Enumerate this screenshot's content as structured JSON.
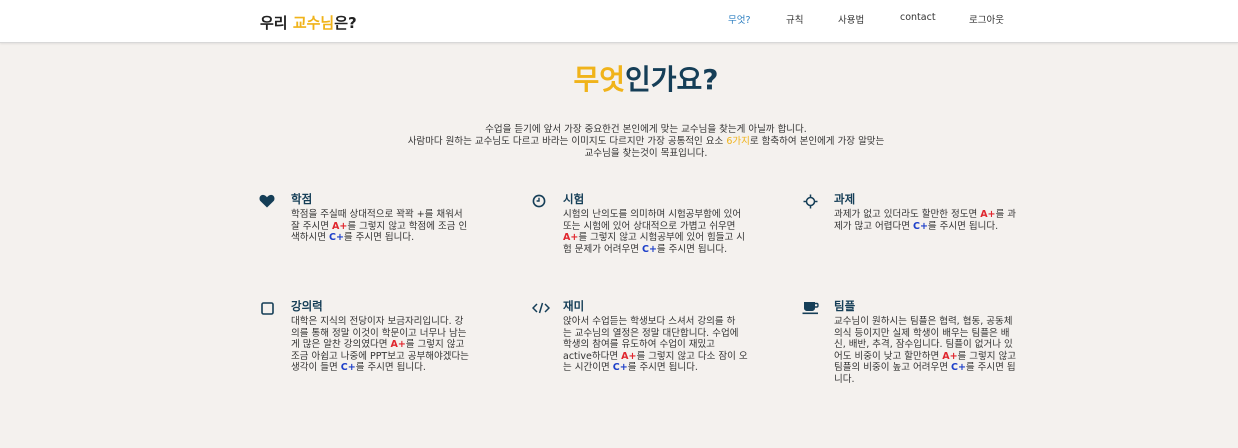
{
  "nav": {
    "brand_prefix": "우리 ",
    "brand_highlight": "교수님",
    "brand_suffix": "은?",
    "links": [
      "무엇?",
      "규칙",
      "사용법",
      "contact",
      "로그아웃"
    ]
  },
  "hero": {
    "title_highlight": "무엇",
    "title_rest": "인가요?"
  },
  "intro": {
    "line1": "수업을 듣기에 앞서 가장 중요한건 본인에게 맞는 교수님을 찾는게 아닐까 합니다.",
    "line2_a": "사람마다 원하는 교수님도 다르고 바라는 이미지도 다르지만 가장 공통적인 요소 ",
    "line2_highlight": "6가지",
    "line2_b": "로 함축하여 본인에게 가장 알맞는",
    "line3": "교수님을 찾는것이 목표입니다."
  },
  "grade_labels": {
    "a": "A+",
    "c": "C+"
  },
  "features": [
    {
      "icon": "heart-icon",
      "title": "학점",
      "lines": [
        [
          "학점을 주실때 상대적으로 꽉꽉 +를 채워서"
        ],
        [
          "잘 주시면 ",
          "@A",
          "를 그렇지 않고 학점에 조금 인"
        ],
        [
          "색하시면 ",
          "@C",
          "를 주시면 됩니다."
        ]
      ]
    },
    {
      "icon": "clock-icon",
      "title": "시험",
      "lines": [
        [
          "시험의 난의도를 의미하며 시험공부함에 있어"
        ],
        [
          "또는 시험에 있어 상대적으로 가볍고 쉬우면"
        ],
        [
          "@A",
          "를 그렇지 않고 시험공부에 있어 힘들고 시"
        ],
        [
          "험 문제가 어려우면 ",
          "@C",
          "를 주시면 됩니다."
        ]
      ]
    },
    {
      "icon": "crosshair-icon",
      "title": "과제",
      "lines": [
        [
          "과제가 없고 있더라도 할만한 정도면 ",
          "@A",
          "를 과"
        ],
        [
          "제가 많고 어렵다면 ",
          "@C",
          "를 주시면 됩니다."
        ]
      ]
    },
    {
      "icon": "square-icon",
      "title": "강의력",
      "lines": [
        [
          "대학은 지식의 전당이자 보금자리입니다. 강"
        ],
        [
          "의를 통해 정말 이것이 학문이고 너무나 남는"
        ],
        [
          "게 많은 알찬 강의였다면 ",
          "@A",
          "를 그렇지 않고"
        ],
        [
          "조금 아쉽고 나중에 PPT보고 공부해야겠다는"
        ],
        [
          "생각이 들면 ",
          "@C",
          "를 주시면 됩니다."
        ]
      ]
    },
    {
      "icon": "code-icon",
      "title": "재미",
      "lines": [
        [
          "앉아서 수업듣는 학생보다 스셔서 강의를 하"
        ],
        [
          "는 교수님의 열정은 정말 대단합니다. 수업에"
        ],
        [
          "학생의 참여를 유도하여 수업이 재밌고"
        ],
        [
          "active하다면 ",
          "@A",
          "를 그렇지 않고 다소 잠이 오"
        ],
        [
          "는 시간이면 ",
          "@C",
          "를 주시면 됩니다."
        ]
      ]
    },
    {
      "icon": "coffee-cup-icon",
      "title": "팀플",
      "lines": [
        [
          "교수님이 원하시는 팀플은 협력, 협동, 공동체"
        ],
        [
          "의식 등이지만 실제 학생이 배우는 팀플은 배"
        ],
        [
          "신, 배반, 추격, 잠수입니다. 팀플이 없거나 있"
        ],
        [
          "어도 비중이 낮고 할만하면 ",
          "@A",
          "를 그렇지 않고"
        ],
        [
          "팀플의 비중이 높고 어려우면 ",
          "@C",
          "를 주시면 됩"
        ],
        [
          "니다."
        ]
      ]
    }
  ]
}
